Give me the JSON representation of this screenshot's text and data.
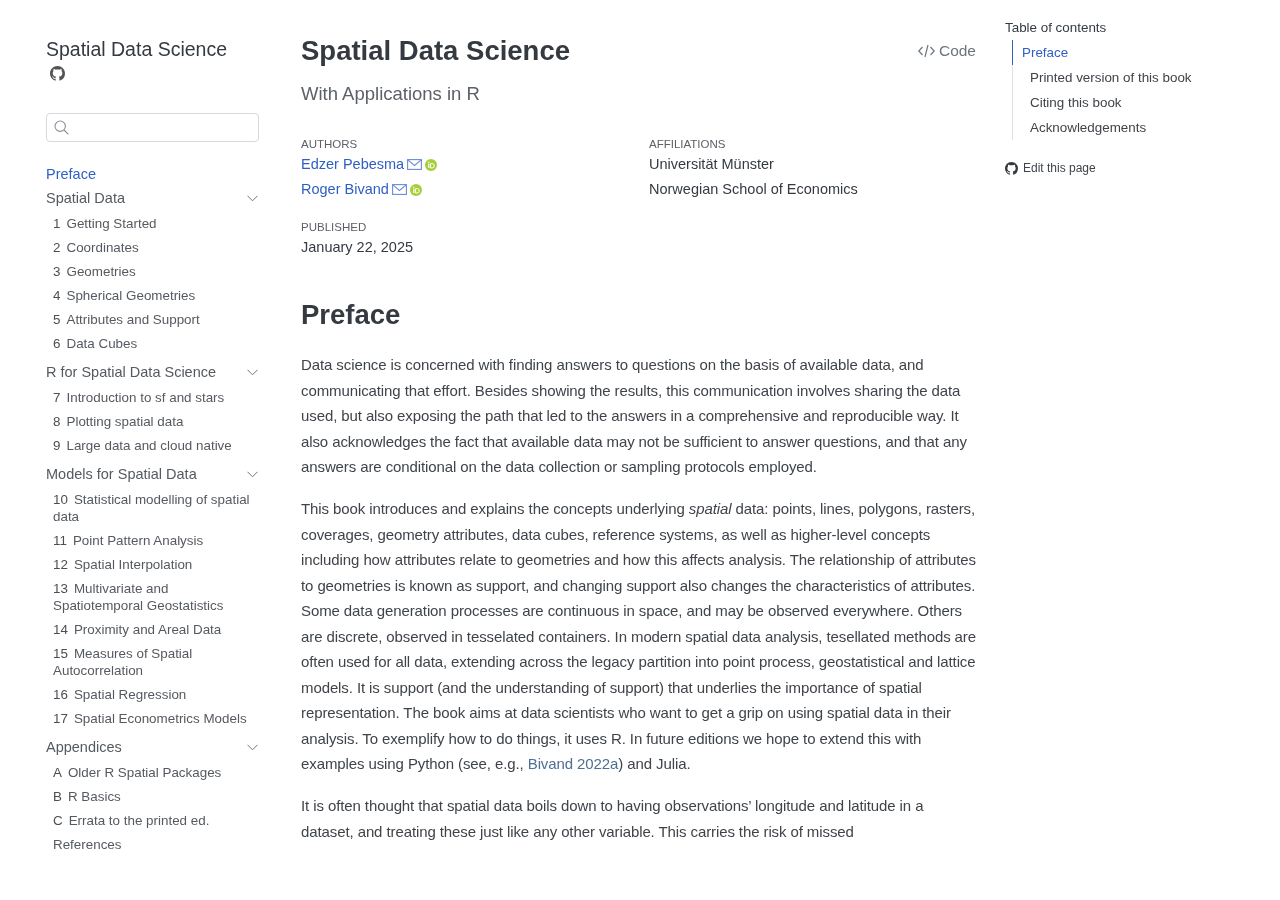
{
  "sidebar": {
    "title": "Spatial Data Science",
    "nav": [
      {
        "kind": "page",
        "title": "Preface",
        "selected": true
      },
      {
        "kind": "section",
        "title": "Spatial Data",
        "selected": false,
        "expanded": true,
        "children": [
          {
            "number": "1",
            "title": "Getting Started",
            "selected": false
          },
          {
            "number": "2",
            "title": "Coordinates",
            "selected": false
          },
          {
            "number": "3",
            "title": "Geometries",
            "selected": false
          },
          {
            "number": "4",
            "title": "Spherical Geometries",
            "selected": false
          },
          {
            "number": "5",
            "title": "Attributes and Support",
            "selected": false
          },
          {
            "number": "6",
            "title": "Data Cubes",
            "selected": false
          }
        ]
      },
      {
        "kind": "section",
        "title": "R for Spatial Data Science",
        "selected": false,
        "expanded": true,
        "children": [
          {
            "number": "7",
            "title": "Introduction to sf and stars",
            "selected": false
          },
          {
            "number": "8",
            "title": "Plotting spatial data",
            "selected": false
          },
          {
            "number": "9",
            "title": "Large data and cloud native",
            "selected": false
          }
        ]
      },
      {
        "kind": "section",
        "title": "Models for Spatial Data",
        "selected": false,
        "expanded": true,
        "children": [
          {
            "number": "10",
            "title": "Statistical modelling of spatial data",
            "selected": false
          },
          {
            "number": "11",
            "title": "Point Pattern Analysis",
            "selected": false
          },
          {
            "number": "12",
            "title": "Spatial Interpolation",
            "selected": false
          },
          {
            "number": "13",
            "title": "Multivariate and Spatiotemporal Geostatistics",
            "selected": false
          },
          {
            "number": "14",
            "title": "Proximity and Areal Data",
            "selected": false
          },
          {
            "number": "15",
            "title": "Measures of Spatial Autocorrelation",
            "selected": false
          },
          {
            "number": "16",
            "title": "Spatial Regression",
            "selected": false
          },
          {
            "number": "17",
            "title": "Spatial Econometrics Models",
            "selected": false
          }
        ]
      },
      {
        "kind": "section",
        "title": "Appendices",
        "selected": false,
        "expanded": true,
        "children": [
          {
            "number": "A",
            "title": "Older R Spatial Packages",
            "selected": false
          },
          {
            "number": "B",
            "title": "R Basics",
            "selected": false
          },
          {
            "number": "C",
            "title": "Errata to the printed ed.",
            "selected": false
          },
          {
            "title": "References",
            "selected": false
          }
        ]
      }
    ]
  },
  "header": {
    "title": "Spatial Data Science",
    "code_button": "Code",
    "subtitle": "With Applications in R",
    "authors_label": "AUTHORS",
    "affiliations_label": "AFFILIATIONS",
    "authors": [
      {
        "name": "Edzer Pebesma",
        "affiliation": "Universität Münster"
      },
      {
        "name": "Roger Bivand",
        "affiliation": "Norwegian School of Economics"
      }
    ],
    "published_label": "PUBLISHED",
    "published": "January 22, 2025"
  },
  "content": {
    "heading": "Preface",
    "paragraphs": [
      {
        "runs": [
          {
            "kind": "text",
            "text": "Data science is concerned with finding answers to questions on the basis of available data, and communicating that effort. Besides showing the results, this communication involves sharing the data used, but also exposing the path that led to the answers in a comprehensive and reproducible way. It also acknowledges the fact that available data may not be sufficient to answer questions, and that any answers are conditional on the data collection or sampling protocols employed."
          }
        ]
      },
      {
        "runs": [
          {
            "kind": "text",
            "text": "This book introduces and explains the concepts underlying *spatial* data: points, lines, polygons, rasters, coverages, geometry attributes, data cubes, reference systems, as well as higher-level concepts including how attributes relate to geometries and how this affects analysis. The relationship of attributes to geometries is known as support, and changing support also changes the characteristics of attributes. Some data generation processes are continuous in space, and may be observed everywhere. Others are discrete, observed in tesselated containers. In modern spatial data analysis, tesellated methods are often used for all data, extending across the legacy partition into point process, geostatistical and lattice models. It is support (and the understanding of support) that underlies the importance of spatial representation. The book aims at data scientists who want to get a grip on using spatial data in their analysis. To exemplify how to do things, it uses R. In future editions we hope to extend this with examples using Python (see, e.g., "
          },
          {
            "kind": "link",
            "text": "Bivand 2022a"
          },
          {
            "kind": "text",
            "text": ") and Julia."
          }
        ]
      },
      {
        "runs": [
          {
            "kind": "text",
            "text": "It is often thought that spatial data boils down to having observations’ longitude and latitude in a dataset, and treating these just like any other variable. This carries the risk of missed"
          }
        ]
      }
    ]
  },
  "toc": {
    "title": "Table of contents",
    "items": [
      {
        "title": "Preface",
        "selected": true,
        "children": [
          {
            "title": "Printed version of this book",
            "selected": false
          },
          {
            "title": "Citing this book",
            "selected": false
          },
          {
            "title": "Acknowledgements",
            "selected": false
          }
        ]
      }
    ],
    "edit_link": "Edit this page"
  }
}
